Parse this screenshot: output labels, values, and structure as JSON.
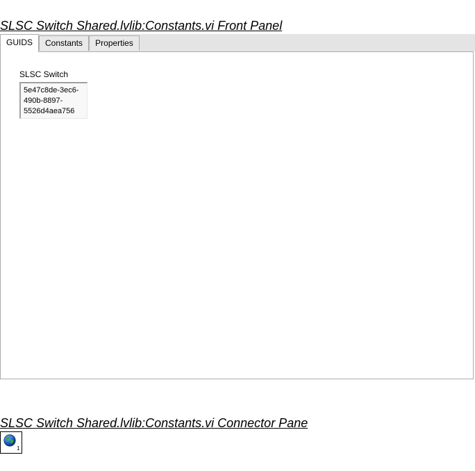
{
  "front_panel": {
    "title": "SLSC Switch Shared.lvlib:Constants.vi Front Panel",
    "tabs": [
      {
        "label": "GUIDS",
        "active": true
      },
      {
        "label": "Constants",
        "active": false
      },
      {
        "label": "Properties",
        "active": false
      }
    ],
    "control": {
      "label": "SLSC Switch",
      "value_lines": [
        "5e47c8de-3ec6-",
        "490b-8897-",
        "5526d4aea756"
      ]
    }
  },
  "connector_pane": {
    "title": "SLSC Switch Shared.lvlib:Constants.vi Connector Pane",
    "icon": "globe-icon",
    "terminal_number": "1"
  }
}
